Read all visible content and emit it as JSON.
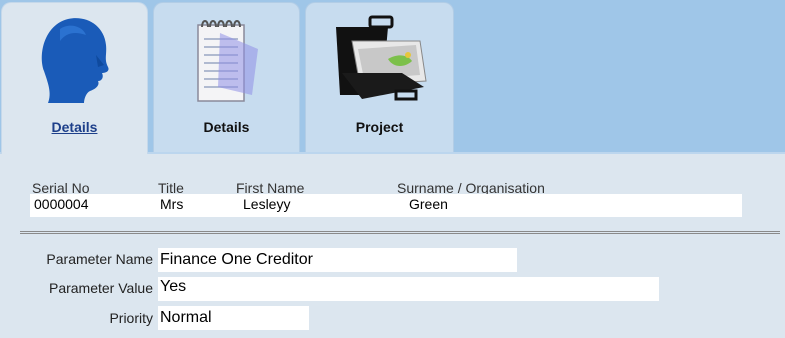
{
  "tabs": [
    {
      "label": "Details",
      "icon": "person-head-icon",
      "active": true
    },
    {
      "label": "Details",
      "icon": "notepad-icon",
      "active": false
    },
    {
      "label": "Project",
      "icon": "briefcase-icon",
      "active": false
    }
  ],
  "summary": {
    "headers": {
      "serial": "Serial No",
      "title": "Title",
      "first_name": "First Name",
      "surname": "Surname / Organisation"
    },
    "values": {
      "serial": "0000004",
      "title": "Mrs",
      "first_name": "Lesleyy",
      "surname": "Green"
    }
  },
  "parameters": {
    "name_label": "Parameter Name",
    "name_value": "Finance One Creditor",
    "value_label": "Parameter Value",
    "value_value": "Yes",
    "priority_label": "Priority",
    "priority_value": "Normal"
  },
  "colors": {
    "tabbar_bg": "#9fc6e8",
    "page_bg": "#dce6ef",
    "active_label": "#1d3f8a"
  }
}
